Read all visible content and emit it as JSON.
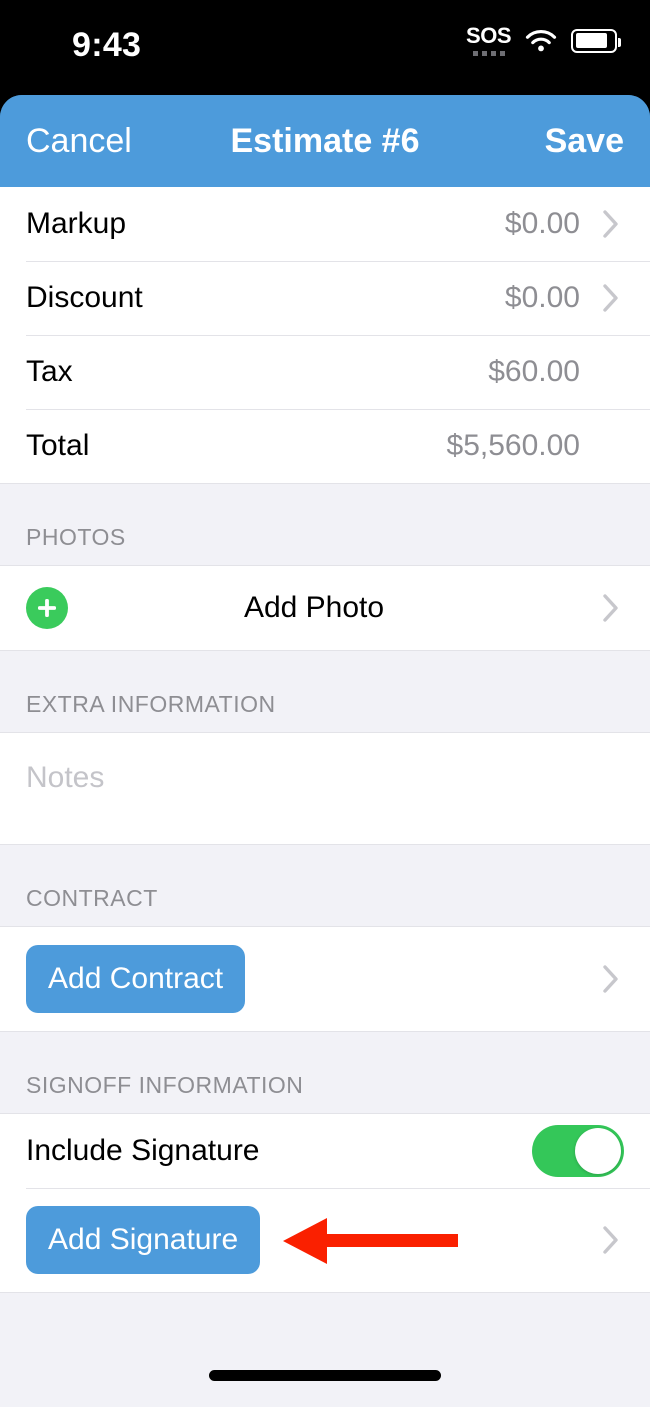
{
  "status_bar": {
    "time": "9:43",
    "sos_label": "SOS",
    "wifi_icon": "wifi-icon",
    "battery_icon": "battery-icon"
  },
  "nav_bar": {
    "cancel_label": "Cancel",
    "title": "Estimate #6",
    "save_label": "Save",
    "background_color": "#4D9BDB"
  },
  "totals_rows": [
    {
      "label": "Markup",
      "value": "$0.00",
      "has_chevron": true
    },
    {
      "label": "Discount",
      "value": "$0.00",
      "has_chevron": true
    },
    {
      "label": "Tax",
      "value": "$60.00",
      "has_chevron": false
    },
    {
      "label": "Total",
      "value": "$5,560.00",
      "has_chevron": false
    }
  ],
  "photos": {
    "header": "PHOTOS",
    "add_label": "Add Photo",
    "plus_icon": "plus-circle-icon",
    "plus_color": "#3ACB5C"
  },
  "extra_information": {
    "header": "EXTRA INFORMATION",
    "notes_placeholder": "Notes",
    "notes_value": ""
  },
  "contract": {
    "header": "CONTRACT",
    "add_label": "Add Contract"
  },
  "signoff": {
    "header": "SIGNOFF INFORMATION",
    "include_signature_label": "Include Signature",
    "include_signature_on": true,
    "toggle_color": "#34C759",
    "add_signature_label": "Add Signature"
  },
  "annotation": {
    "arrow_color": "#FA2000",
    "points_to": "Add Signature"
  }
}
